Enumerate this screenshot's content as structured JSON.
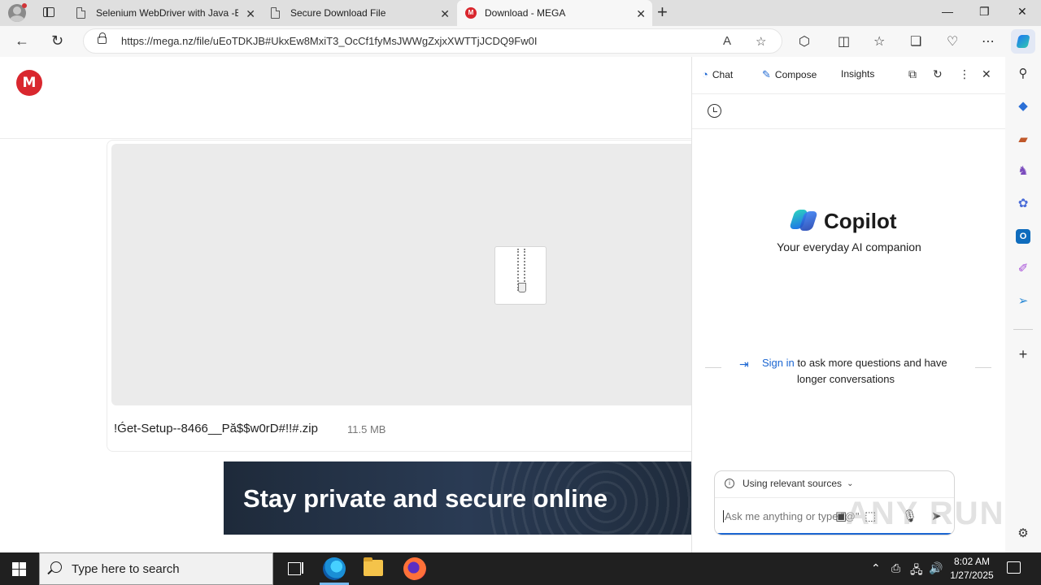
{
  "tabs": [
    {
      "title": "Selenium WebDriver with Java -B"
    },
    {
      "title": "Secure Download File"
    },
    {
      "title": "Download - MEGA",
      "favicon": "M"
    }
  ],
  "address": {
    "url": "https://mega.nz/file/uEoTDKJB#UkxEw8MxiT3_OcCf1fyMsJWWgZxjxXWTTjJCDQ9Fw0I"
  },
  "page": {
    "logo": "M",
    "file_name": "!Ǵet-Setup--8466__Pă$$w0rD#!!#.zip",
    "file_size": "11.5 MB",
    "banner_text": "Stay private and secure online"
  },
  "copilot": {
    "tabs": [
      "Chat",
      "Compose",
      "Insights"
    ],
    "title": "Copilot",
    "subtitle": "Your everyday AI companion",
    "sign_in_link": "Sign in",
    "sign_in_rest": " to ask more questions and have",
    "sign_in_line2": "longer conversations",
    "sources_label": "Using relevant sources",
    "input_placeholder": "Ask me anything or type \"@\""
  },
  "watermark": "ANY RUN",
  "taskbar": {
    "search_placeholder": "Type here to search",
    "time": "8:02 AM",
    "date": "1/27/2025"
  },
  "colors": {
    "mega_red": "#d9272e",
    "link_blue": "#1b66d2",
    "taskbar": "#202020"
  }
}
